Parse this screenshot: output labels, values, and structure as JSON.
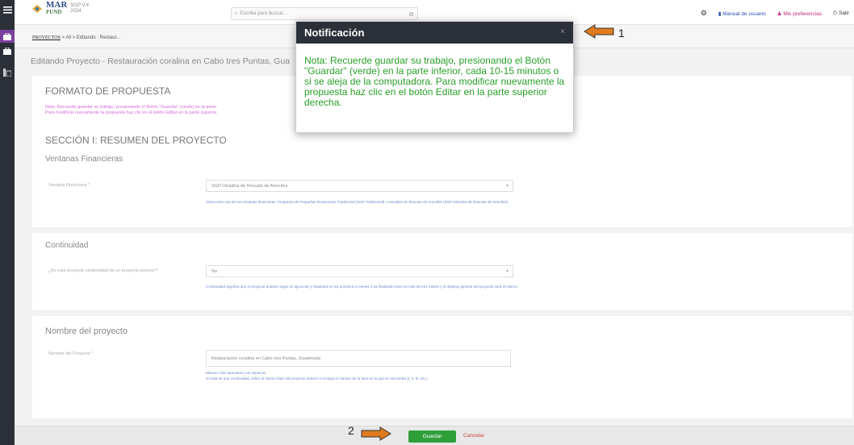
{
  "header": {
    "logo": {
      "line1": "MAR",
      "line2": "FUND",
      "sub1": "SGP V.4",
      "sub2": "2024"
    },
    "search_placeholder": "Escriba para buscar...",
    "manual": "Manual de usuario",
    "preferences": "Mis preferencias",
    "exit": "Salir"
  },
  "breadcrumb": {
    "project": "PROYECTOS",
    "rest": " > All > Editando : Restaur..."
  },
  "page_title": "Editando Proyecto - Restauración coralina en Cabo tres Puntas, Gua",
  "form": {
    "heading": "FORMATO DE PROPUESTA",
    "note_line1": "Nota: Recuerde guardar su trabajo, presionando el Botón \"Guardar\" (verde) en la parte",
    "note_line2": "Para modificar nuevamente la propuesta haz clic en el botón Editar en la parte superior",
    "section1": "SECCIÓN I: RESUMEN DEL PROYECTO",
    "ventanas": {
      "title": "Ventanas Financieras",
      "label": "Ventana Financiera *",
      "value": "SGP Iniciativa de Rescate de Arrecifes",
      "help": "Seleccione una de las ventanas financieras: Programa de Pequeñas Donaciones Tradicional (SGP Tradicional) o Iniciativa de Rescate de Arrecifes (SGP Iniciativa de Rescate de Arrecifes)"
    },
    "continuidad": {
      "title": "Continuidad",
      "label": "¿Es este proyecto continuidad de un proyecto anterior?",
      "value": "No",
      "help": "Continuidad significa que el proyecto anterior sigue en ejecución y finalizará en los próximos 6 meses o ha finalizado hace no más de tres meses y el objetivo general del proyecto será el mismo."
    },
    "nombre": {
      "title": "Nombre del proyecto",
      "label": "Nombre del Proyecto *",
      "value": "Restauración coralina en Cabo tres Puntas, Guatemala",
      "help1": "Máximo 100 caracteres con espacios.",
      "help2": "Si trata de una continuidad, utilice el mismo título del proyecto anterior e incluya el número de la fase en la que se encuentra (I, II, III, etc.)"
    }
  },
  "footer": {
    "save": "Guardar",
    "cancel": "Cancelar"
  },
  "modal": {
    "title": "Notificación",
    "close": "×",
    "body": "Nota: Recuerde guardar su trabajo, presionando el Botón \"Guardar\" (verde) en la parte inferior, cada 10-15 minutos o si se aleja de la computadora. Para modificar nuevamente la propuesta haz clic en el botón Editar en la parte superior derecha."
  },
  "annotations": {
    "one": "1",
    "two": "2"
  },
  "colors": {
    "accent": "#7b3f9e",
    "save": "#2f9f3a",
    "modal_text": "#28a028",
    "arrow": "#e07b1e"
  }
}
